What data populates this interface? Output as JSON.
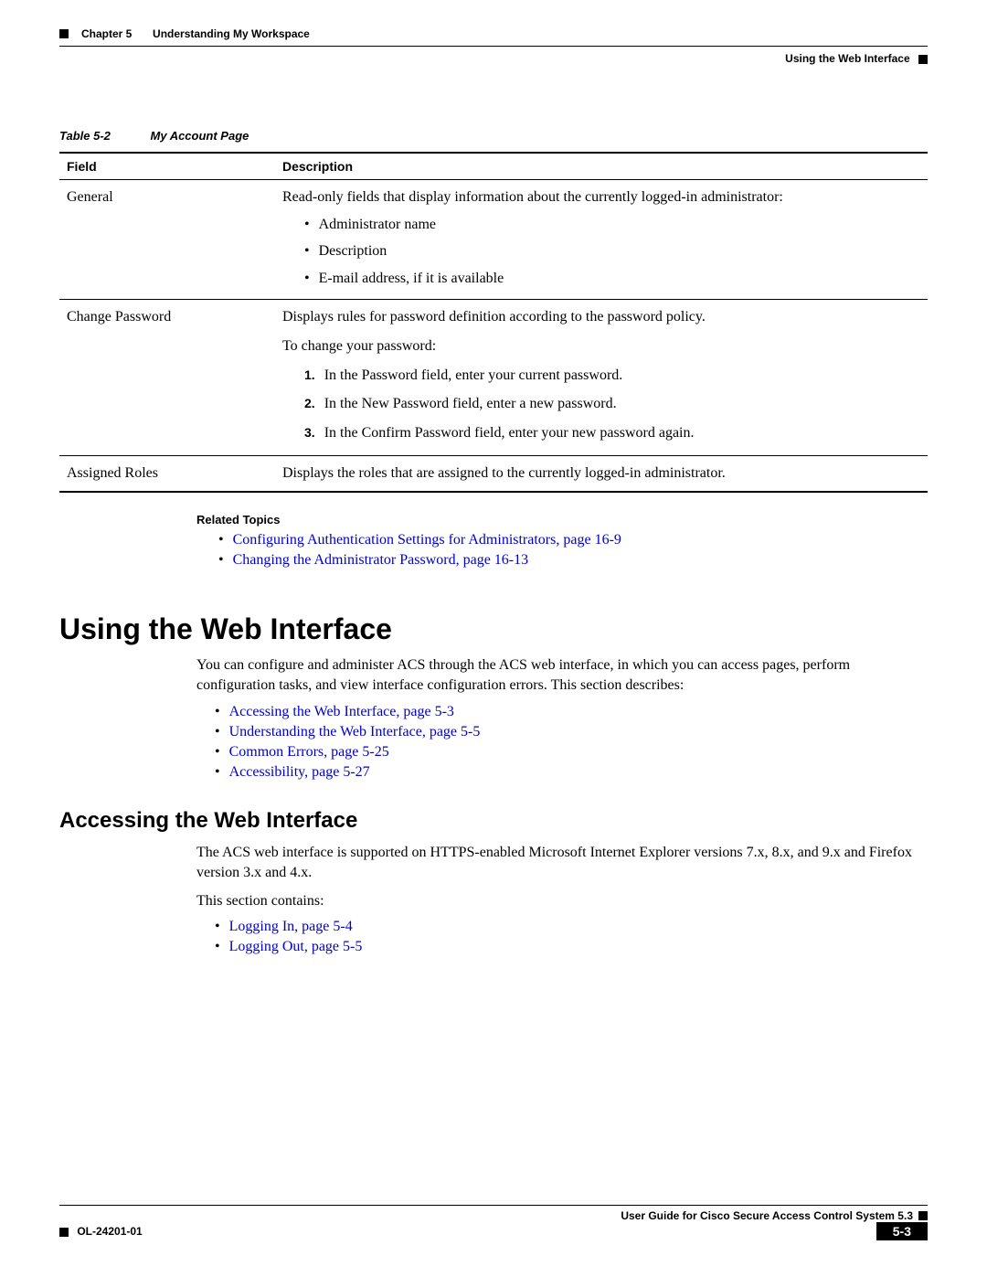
{
  "header": {
    "chapter": "Chapter 5",
    "chapterTitle": "Understanding My Workspace",
    "section": "Using the Web Interface"
  },
  "tableCaption": {
    "label": "Table 5-2",
    "title": "My Account Page"
  },
  "tableHeaders": {
    "field": "Field",
    "desc": "Description"
  },
  "tableRows": {
    "general": {
      "field": "General",
      "desc": "Read-only fields that display information about the currently logged-in administrator:",
      "bullets": {
        "b1": "Administrator name",
        "b2": "Description",
        "b3": "E-mail address, if it is available"
      }
    },
    "changePassword": {
      "field": "Change Password",
      "line1": "Displays rules for password definition according to the password policy.",
      "line2": "To change your password:",
      "steps": {
        "s1": "In the Password field, enter your current password.",
        "s2": "In the New Password field, enter a new password.",
        "s3": "In the Confirm Password field, enter your new password again."
      }
    },
    "assignedRoles": {
      "field": "Assigned Roles",
      "desc": "Displays the roles that are assigned to the currently logged-in administrator."
    }
  },
  "relatedTopics": {
    "heading": "Related Topics",
    "t1": "Configuring Authentication Settings for Administrators, page 16-9",
    "t2": "Changing the Administrator Password, page 16-13"
  },
  "h1": "Using the Web Interface",
  "p1": "You can configure and administer ACS through the ACS web interface, in which you can access pages, perform configuration tasks, and view interface configuration errors. This section describes:",
  "links1": {
    "l1": "Accessing the Web Interface, page 5-3",
    "l2": "Understanding the Web Interface, page 5-5",
    "l3": "Common Errors, page 5-25",
    "l4": "Accessibility, page 5-27"
  },
  "h2": "Accessing the Web Interface",
  "p2": "The ACS web interface is supported on HTTPS-enabled Microsoft Internet Explorer versions 7.x, 8.x, and 9.x and Firefox version 3.x and 4.x.",
  "p3": "This section contains:",
  "links2": {
    "l1": "Logging In, page 5-4",
    "l2": "Logging Out, page 5-5"
  },
  "footer": {
    "guide": "User Guide for Cisco Secure Access Control System 5.3",
    "docId": "OL-24201-01",
    "pageNum": "5-3"
  }
}
